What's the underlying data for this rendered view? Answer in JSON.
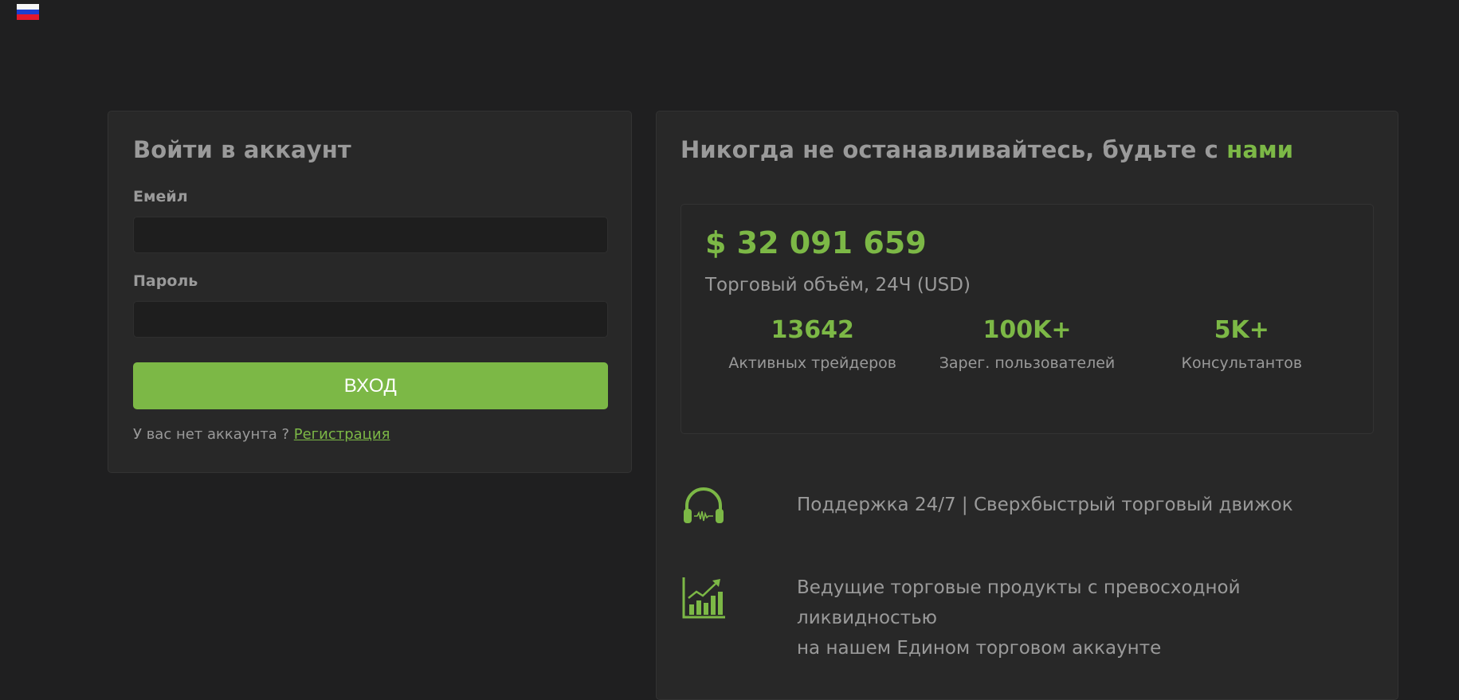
{
  "language": {
    "icon": "russian-flag-icon",
    "colors": [
      "#f7f7f7",
      "#1c3fd0",
      "#e3182b"
    ]
  },
  "login": {
    "title": "Войти в аккаунт",
    "email_label": "Емейл",
    "email_value": "",
    "password_label": "Пароль",
    "password_value": "",
    "submit_label": "ВХОД",
    "no_account_text": "У вас нет аккаунта ? ",
    "register_link": "Регистрация"
  },
  "promo": {
    "headline_main": "Никогда не останавливайтесь, будьте с ",
    "headline_accent": "нами",
    "volume_value": "$ 32 091 659",
    "volume_label": "Торговый объём, 24Ч (USD)",
    "stats": [
      {
        "value": "13642",
        "label": "Активных трейдеров"
      },
      {
        "value": "100K+",
        "label": "Зарег. пользователей"
      },
      {
        "value": "5K+",
        "label": "Консультантов"
      }
    ],
    "features": [
      {
        "icon": "headphones-icon",
        "text": "Поддержка 24/7 | Сверхбыстрый торговый движок"
      },
      {
        "icon": "chart-growth-icon",
        "text_line1": "Ведущие торговые продукты с превосходной ликвидностью",
        "text_line2": "на нашем Едином торговом аккаунте"
      }
    ]
  },
  "colors": {
    "background": "#1f1f20",
    "card": "#282828",
    "accent": "#7cb846",
    "text_muted": "#9a9a9a"
  }
}
